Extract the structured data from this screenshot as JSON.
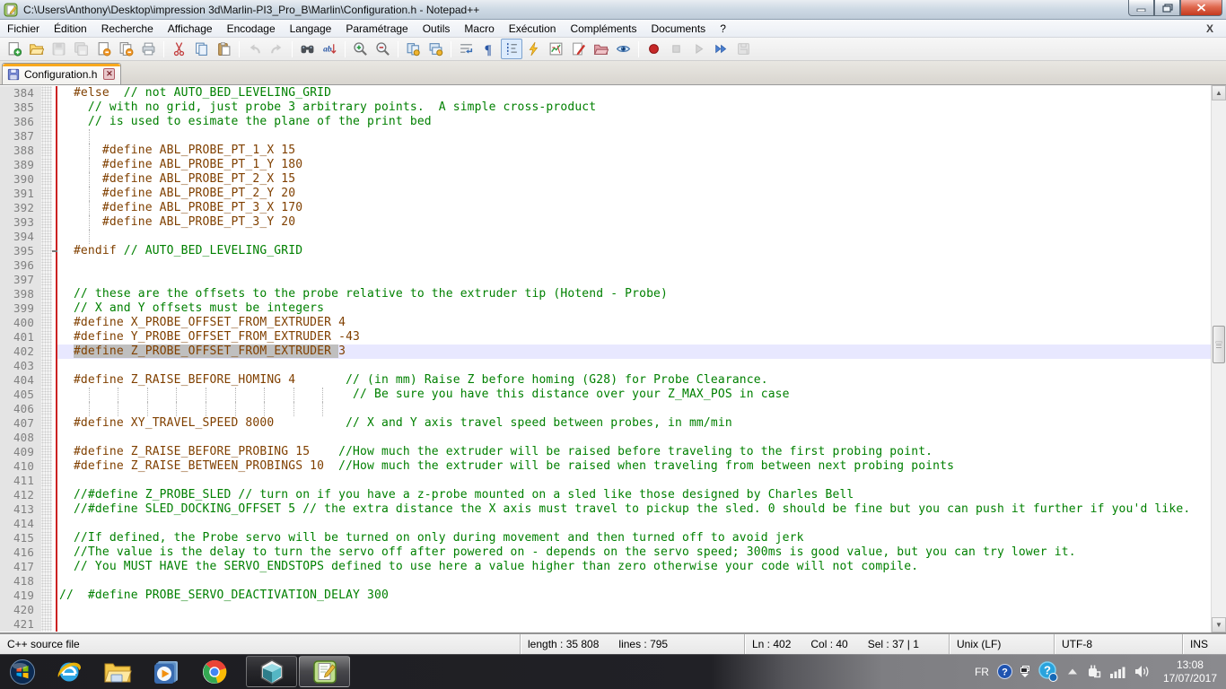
{
  "colors": {
    "preprocessor": "#804000",
    "comment": "#008000",
    "selection_bg": "#bfbfbf",
    "current_line_bg": "#e8e8ff",
    "line_number": "#808080",
    "tab_accent": "#f8a81c",
    "fold_edge_line": "#cc2222"
  },
  "window": {
    "title": "C:\\Users\\Anthony\\Desktop\\impression 3d\\Marlin-PI3_Pro_B\\Marlin\\Configuration.h - Notepad++"
  },
  "menu": {
    "items": [
      "Fichier",
      "Édition",
      "Recherche",
      "Affichage",
      "Encodage",
      "Langage",
      "Paramétrage",
      "Outils",
      "Macro",
      "Exécution",
      "Compléments",
      "Documents",
      "?"
    ],
    "close_label": "X"
  },
  "toolbar": {
    "buttons": [
      {
        "name": "new-file-icon"
      },
      {
        "name": "open-file-icon"
      },
      {
        "name": "save-icon",
        "disabled": true
      },
      {
        "name": "save-all-icon",
        "disabled": true
      },
      {
        "name": "close-file-icon"
      },
      {
        "name": "close-all-icon"
      },
      {
        "name": "print-icon"
      },
      {
        "sep": true
      },
      {
        "name": "cut-icon"
      },
      {
        "name": "copy-icon"
      },
      {
        "name": "paste-icon"
      },
      {
        "sep": true
      },
      {
        "name": "undo-icon",
        "disabled": true
      },
      {
        "name": "redo-icon",
        "disabled": true
      },
      {
        "sep": true
      },
      {
        "name": "find-icon"
      },
      {
        "name": "replace-icon"
      },
      {
        "sep": true
      },
      {
        "name": "zoom-in-icon"
      },
      {
        "name": "zoom-out-icon"
      },
      {
        "sep": true
      },
      {
        "name": "sync-vertical-icon"
      },
      {
        "name": "sync-horizontal-icon"
      },
      {
        "sep": true
      },
      {
        "name": "word-wrap-icon"
      },
      {
        "name": "show-all-characters-icon"
      },
      {
        "name": "show-indent-guide-icon",
        "pressed": true
      },
      {
        "name": "function-completion-icon"
      },
      {
        "name": "document-map-icon"
      },
      {
        "name": "edit-marker-icon"
      },
      {
        "name": "folder-monitor-icon"
      },
      {
        "name": "view-file-icon"
      },
      {
        "sep": true
      },
      {
        "name": "macro-record-icon"
      },
      {
        "name": "macro-stop-icon",
        "disabled": true
      },
      {
        "name": "macro-play-icon",
        "disabled": true
      },
      {
        "name": "macro-run-multiple-icon"
      },
      {
        "name": "macro-save-icon",
        "disabled": true
      }
    ]
  },
  "tabbar": {
    "tabs": [
      {
        "label": "Configuration.h",
        "active": true
      }
    ]
  },
  "editor": {
    "lines": [
      {
        "n": 384,
        "t": [
          [
            "p",
            "  #else  "
          ],
          [
            "c",
            "// not AUTO_BED_LEVELING_GRID"
          ]
        ]
      },
      {
        "n": 385,
        "t": [
          [
            "c",
            "    // with no grid, just probe 3 arbitrary points.  A simple cross-product"
          ]
        ]
      },
      {
        "n": 386,
        "t": [
          [
            "c",
            "    // is used to esimate the plane of the print bed"
          ]
        ]
      },
      {
        "n": 387,
        "t": [],
        "guides": [
          4
        ]
      },
      {
        "n": 388,
        "t": [
          [
            "p",
            "      #define ABL_PROBE_PT_1_X 15"
          ]
        ],
        "guides": [
          4
        ]
      },
      {
        "n": 389,
        "t": [
          [
            "p",
            "      #define ABL_PROBE_PT_1_Y 180"
          ]
        ],
        "guides": [
          4
        ]
      },
      {
        "n": 390,
        "t": [
          [
            "p",
            "      #define ABL_PROBE_PT_2_X 15"
          ]
        ],
        "guides": [
          4
        ]
      },
      {
        "n": 391,
        "t": [
          [
            "p",
            "      #define ABL_PROBE_PT_2_Y 20"
          ]
        ],
        "guides": [
          4
        ]
      },
      {
        "n": 392,
        "t": [
          [
            "p",
            "      #define ABL_PROBE_PT_3_X 170"
          ]
        ],
        "guides": [
          4
        ]
      },
      {
        "n": 393,
        "t": [
          [
            "p",
            "      #define ABL_PROBE_PT_3_Y 20"
          ]
        ],
        "guides": [
          4
        ]
      },
      {
        "n": 394,
        "t": [],
        "guides": [
          4
        ]
      },
      {
        "n": 395,
        "t": [
          [
            "p",
            "  #endif "
          ],
          [
            "c",
            "// AUTO_BED_LEVELING_GRID"
          ]
        ],
        "fold": true
      },
      {
        "n": 396,
        "t": []
      },
      {
        "n": 397,
        "t": []
      },
      {
        "n": 398,
        "t": [
          [
            "c",
            "  // these are the offsets to the probe relative to the extruder tip (Hotend - Probe)"
          ]
        ]
      },
      {
        "n": 399,
        "t": [
          [
            "c",
            "  // X and Y offsets must be integers"
          ]
        ]
      },
      {
        "n": 400,
        "t": [
          [
            "p",
            "  #define X_PROBE_OFFSET_FROM_EXTRUDER 4"
          ]
        ]
      },
      {
        "n": 401,
        "t": [
          [
            "p",
            "  #define Y_PROBE_OFFSET_FROM_EXTRUDER -43"
          ]
        ]
      },
      {
        "n": 402,
        "t": [
          [
            "t",
            "  "
          ],
          [
            "s",
            "#define Z_PROBE_OFFSET_FROM_EXTRUDER "
          ],
          [
            "p",
            "3"
          ]
        ],
        "current": true
      },
      {
        "n": 403,
        "t": []
      },
      {
        "n": 404,
        "t": [
          [
            "p",
            "  #define Z_RAISE_BEFORE_HOMING 4       "
          ],
          [
            "c",
            "// (in mm) Raise Z before homing (G28) for Probe Clearance."
          ]
        ]
      },
      {
        "n": 405,
        "t": [
          [
            "c",
            "                                         // Be sure you have this distance over your Z_MAX_POS in case"
          ]
        ],
        "guides": [
          4,
          8,
          12,
          16,
          20,
          24,
          28,
          32,
          36
        ]
      },
      {
        "n": 406,
        "t": [],
        "guides": [
          4,
          8,
          12,
          16,
          20,
          24,
          28,
          32,
          36
        ]
      },
      {
        "n": 407,
        "t": [
          [
            "p",
            "  #define XY_TRAVEL_SPEED 8000          "
          ],
          [
            "c",
            "// X and Y axis travel speed between probes, in mm/min"
          ]
        ]
      },
      {
        "n": 408,
        "t": []
      },
      {
        "n": 409,
        "t": [
          [
            "p",
            "  #define Z_RAISE_BEFORE_PROBING 15    "
          ],
          [
            "c",
            "//How much the extruder will be raised before traveling to the first probing point."
          ]
        ]
      },
      {
        "n": 410,
        "t": [
          [
            "p",
            "  #define Z_RAISE_BETWEEN_PROBINGS 10  "
          ],
          [
            "c",
            "//How much the extruder will be raised when traveling from between next probing points"
          ]
        ]
      },
      {
        "n": 411,
        "t": []
      },
      {
        "n": 412,
        "t": [
          [
            "c",
            "  //#define Z_PROBE_SLED // turn on if you have a z-probe mounted on a sled like those designed by Charles Bell"
          ]
        ]
      },
      {
        "n": 413,
        "t": [
          [
            "c",
            "  //#define SLED_DOCKING_OFFSET 5 // the extra distance the X axis must travel to pickup the sled. 0 should be fine but you can push it further if you'd like."
          ]
        ]
      },
      {
        "n": 414,
        "t": []
      },
      {
        "n": 415,
        "t": [
          [
            "c",
            "  //If defined, the Probe servo will be turned on only during movement and then turned off to avoid jerk"
          ]
        ]
      },
      {
        "n": 416,
        "t": [
          [
            "c",
            "  //The value is the delay to turn the servo off after powered on - depends on the servo speed; 300ms is good value, but you can try lower it."
          ]
        ]
      },
      {
        "n": 417,
        "t": [
          [
            "c",
            "  // You MUST HAVE the SERVO_ENDSTOPS defined to use here a value higher than zero otherwise your code will not compile."
          ]
        ]
      },
      {
        "n": 418,
        "t": []
      },
      {
        "n": 419,
        "t": [
          [
            "c",
            "//  #define PROBE_SERVO_DEACTIVATION_DELAY 300"
          ]
        ]
      },
      {
        "n": 420,
        "t": []
      },
      {
        "n": 421,
        "t": []
      }
    ]
  },
  "statusbar": {
    "doc_type": "C++ source file",
    "length": "length : 35 808",
    "lines": "lines : 795",
    "ln": "Ln : 402",
    "col": "Col : 40",
    "sel": "Sel : 37 | 1",
    "eol": "Unix (LF)",
    "encoding": "UTF-8",
    "mode": "INS"
  },
  "taskbar": {
    "tray_lang": "FR",
    "clock_time": "13:08",
    "clock_date": "17/07/2017"
  }
}
